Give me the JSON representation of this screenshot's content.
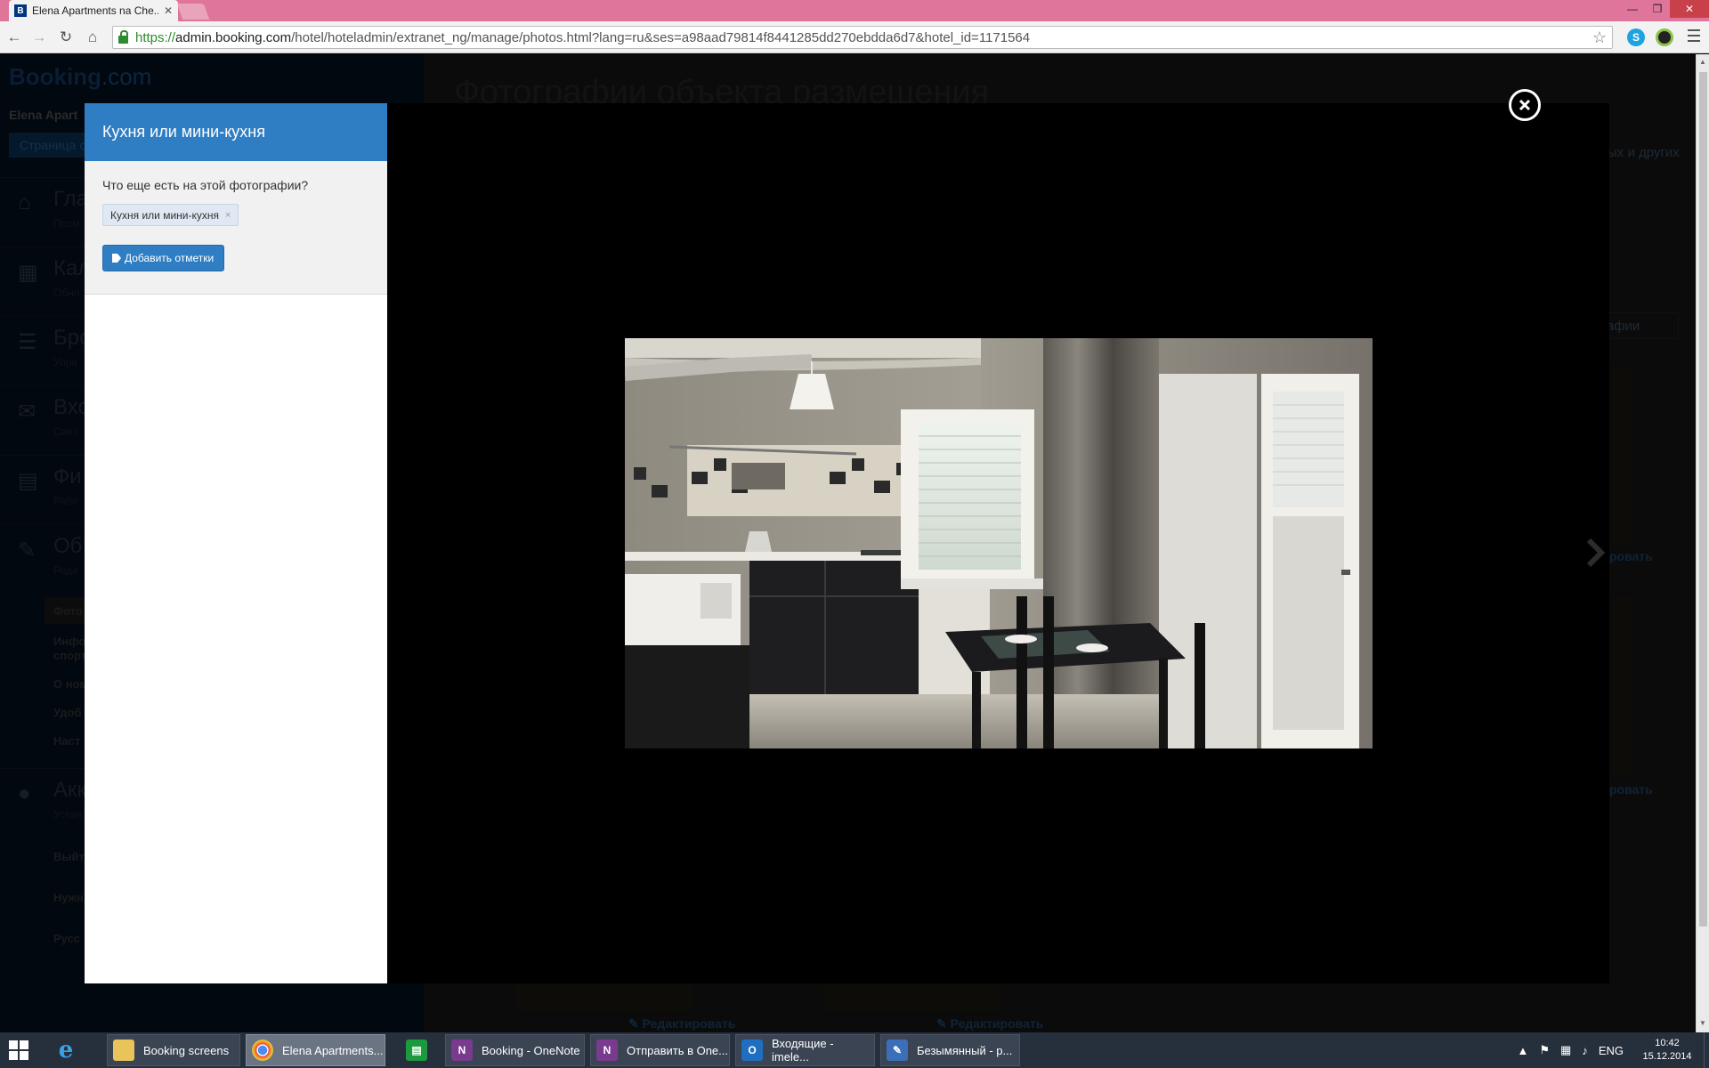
{
  "browser": {
    "tab_title": "Elena Apartments na Che...",
    "tab_favicon": "B",
    "url_scheme": "https://",
    "url_host": "admin.booking.com",
    "url_path": "/hotel/hoteladmin/extranet_ng/manage/photos.html?lang=ru&ses=a98aad79814f8441285dd270ebdda6d7&hotel_id=1171564",
    "skype_icon": "S"
  },
  "background_page": {
    "logo_main": "Booking",
    "logo_dot": ".com",
    "property_name": "Elena Apart",
    "property_button": "Страница с",
    "nav": [
      {
        "title": "Гла",
        "subtitle": "Посм"
      },
      {
        "title": "Кал",
        "subtitle": "Обно"
      },
      {
        "title": "Бро",
        "subtitle": "Упра"
      },
      {
        "title": "Вхо",
        "subtitle": "Связ"
      },
      {
        "title": "Фи",
        "subtitle": "Рабо"
      },
      {
        "title": "Об",
        "subtitle": "Реда"
      },
      {
        "title": "Акк",
        "subtitle": "Устан"
      }
    ],
    "subnav": [
      "Фото",
      "Инфо",
      "спорт",
      "О ном",
      "Удоб",
      "Наст"
    ],
    "logout": "Выйт",
    "help": "Нужн",
    "language": "Русс",
    "heading": "Фотографии объекта размещения",
    "frag_right": "ых и других",
    "frag_photos_button": "графии",
    "edit_link": "Редактировать",
    "edit_short": "ровать"
  },
  "lightbox": {
    "panel_title": "Кухня или мини-кухня",
    "question": "Что еще есть на этой фотографии?",
    "tag_label": "Кухня или мини-кухня",
    "tag_remove": "×",
    "add_tags_button": "Добавить отметки"
  },
  "taskbar": {
    "items": [
      {
        "label": "Booking screens",
        "icon": "folder-icon"
      },
      {
        "label": "Elena Apartments...",
        "icon": "chrome-icon"
      },
      {
        "label": "Booking - OneNote",
        "icon": "onenote-icon"
      },
      {
        "label": "Отправить в One...",
        "icon": "onenote-clip-icon"
      },
      {
        "label": "Входящие - imele...",
        "icon": "outlook-icon"
      },
      {
        "label": "Безымянный - p...",
        "icon": "paint-icon"
      }
    ],
    "language": "ENG",
    "time": "10:42",
    "date": "15.12.2014"
  }
}
